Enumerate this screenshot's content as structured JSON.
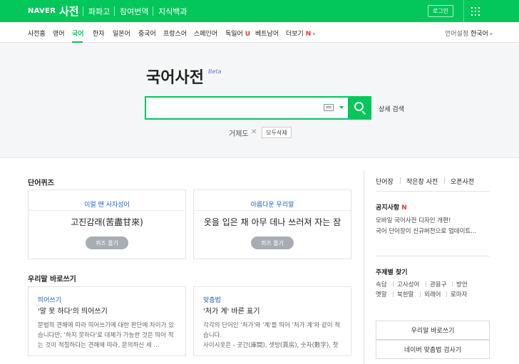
{
  "topbar": {
    "logo": "NAVER",
    "service": "사전",
    "links": [
      "파파고",
      "참여번역",
      "지식백과"
    ],
    "login": "로그인",
    "menu_icon": "grid-icon"
  },
  "nav": {
    "items": [
      "사전홈",
      "영어",
      "국어",
      "한자",
      "일본어",
      "중국어",
      "프랑스어",
      "스페인어",
      "독일어",
      "베트남어",
      "더보기"
    ],
    "new_mark_deutsch": "U",
    "new_mark_more": "N",
    "lang_label": "언어설정",
    "lang_value": "한국어"
  },
  "search": {
    "title": "국어사전",
    "beta": "Beta",
    "placeholder": "",
    "detail_link": "상세 검색",
    "recent_term": "거제도",
    "clear_button": "모두삭제"
  },
  "quiz": {
    "section_title": "단어퀴즈",
    "cards": [
      {
        "category": "이럴 땐 사자성어",
        "question": "고진감래(苦盡甘來)",
        "button": "퀴즈 풀기"
      },
      {
        "category": "아름다운 우리말",
        "question": "옷을 입은 채 아무 데나 쓰러져 자는 잠",
        "button": "퀴즈 풀기"
      }
    ]
  },
  "spelling": {
    "section_title": "우리말 바로쓰기",
    "cards": [
      {
        "category": "띄어쓰기",
        "headline": "'말 못 하다'의 띄어쓰기",
        "lines": [
          "문법적 견해에 따라 띄어쓰기에 대한 판단에 차이가 있",
          "습니다만, '하지 못하다'로 대체가 가능한 것은 띄어 적",
          "는 것이 적절하다는 견해에 따라, 문의하신 세 ..."
        ]
      },
      {
        "category": "맞춤법",
        "headline": "'처가 계' 바른 표기",
        "lines": [
          "각각의 단어인 '처가'와 '계'를 띄어 '처가 계'와 같이 적",
          "습니다.",
          "사이시옷은 - 곳간(庫間), 셋방(貰房), 숫자(數字), 찻"
        ]
      }
    ]
  },
  "side": {
    "tabs": [
      "단어장",
      "작은창 사전",
      "오픈사전"
    ],
    "notice_title": "공지사항",
    "notice_new": "N",
    "notices": [
      "모바일 국어사전 디자인 개편!",
      "국어 단어장이 신규버전으로 업데이트..."
    ],
    "topics_title": "주제별 찾기",
    "topics_row1": [
      "속담",
      "고사성어",
      "관용구",
      "방언"
    ],
    "topics_row2": [
      "옛말",
      "북한말",
      "외래어",
      "로마자"
    ],
    "buttons": [
      "우리말 바로쓰기",
      "네이버 맞춤법 검사기"
    ]
  },
  "colors": {
    "brand": "#03c75a",
    "link_blue": "#1e63c6",
    "new_red": "#e43d30"
  }
}
